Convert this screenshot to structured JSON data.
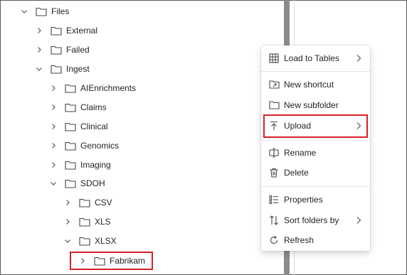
{
  "tree": {
    "files": "Files",
    "external": "External",
    "failed": "Failed",
    "ingest": "Ingest",
    "aienrichments": "AIEnrichments",
    "claims": "Claims",
    "clinical": "Clinical",
    "genomics": "Genomics",
    "imaging": "Imaging",
    "sdoh": "SDOH",
    "csv": "CSV",
    "xls": "XLS",
    "xlsx": "XLSX",
    "fabrikam": "Fabrikam"
  },
  "context_menu": {
    "load_to_tables": "Load to Tables",
    "new_shortcut": "New shortcut",
    "new_subfolder": "New subfolder",
    "upload": "Upload",
    "rename": "Rename",
    "delete": "Delete",
    "properties": "Properties",
    "sort_folders_by": "Sort folders by",
    "refresh": "Refresh"
  },
  "icons": {
    "expanded": "chevron-down-icon",
    "collapsed": "chevron-right-icon",
    "folder": "folder-icon"
  },
  "colors": {
    "highlight": "#d62027",
    "divider_bar": "#8c8c8c"
  }
}
